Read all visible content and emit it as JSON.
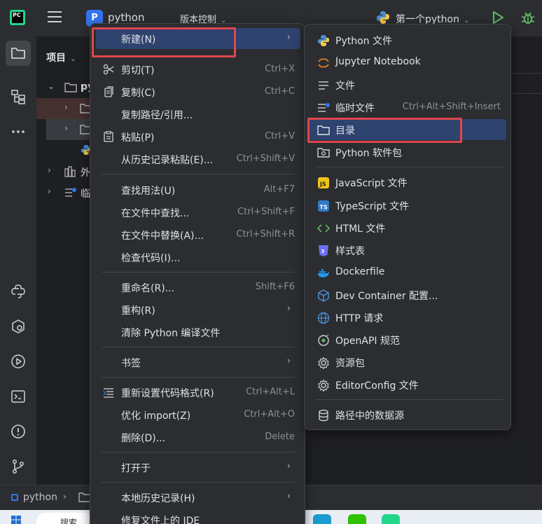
{
  "titlebar": {
    "app_icon_text": "PC",
    "project_initial": "P",
    "project_name": "python",
    "vcs_label": "版本控制",
    "run_config": "第一个python"
  },
  "panel": {
    "title": "项目",
    "tree": [
      {
        "text": "py"
      },
      {
        "text": ""
      },
      {
        "text": ""
      },
      {
        "text": ""
      },
      {
        "text": "外"
      },
      {
        "text": "临"
      }
    ]
  },
  "context_menu": {
    "items": [
      {
        "label": "新建(N)",
        "shortcut": "",
        "submenu": true
      },
      {
        "label": "剪切(T)",
        "shortcut": "Ctrl+X"
      },
      {
        "label": "复制(C)",
        "shortcut": "Ctrl+C"
      },
      {
        "label": "复制路径/引用...",
        "shortcut": ""
      },
      {
        "label": "粘贴(P)",
        "shortcut": "Ctrl+V"
      },
      {
        "label": "从历史记录粘贴(E)...",
        "shortcut": "Ctrl+Shift+V"
      },
      {
        "label": "查找用法(U)",
        "shortcut": "Alt+F7"
      },
      {
        "label": "在文件中查找...",
        "shortcut": "Ctrl+Shift+F"
      },
      {
        "label": "在文件中替换(A)...",
        "shortcut": "Ctrl+Shift+R"
      },
      {
        "label": "检查代码(I)...",
        "shortcut": ""
      },
      {
        "label": "重命名(R)...",
        "shortcut": "Shift+F6"
      },
      {
        "label": "重构(R)",
        "shortcut": "",
        "submenu": true
      },
      {
        "label": "清除 Python 编译文件",
        "shortcut": ""
      },
      {
        "label": "书签",
        "shortcut": "",
        "submenu": true
      },
      {
        "label": "重新设置代码格式(R)",
        "shortcut": "Ctrl+Alt+L"
      },
      {
        "label": "优化 import(Z)",
        "shortcut": "Ctrl+Alt+O"
      },
      {
        "label": "删除(D)...",
        "shortcut": "Delete"
      },
      {
        "label": "打开于",
        "shortcut": "",
        "submenu": true
      },
      {
        "label": "本地历史记录(H)",
        "shortcut": "",
        "submenu": true
      },
      {
        "label": "修复文件上的 IDE",
        "shortcut": ""
      }
    ]
  },
  "submenu": {
    "items": [
      {
        "label": "Python 文件",
        "shortcut": ""
      },
      {
        "label": "Jupyter Notebook",
        "shortcut": ""
      },
      {
        "label": "文件",
        "shortcut": ""
      },
      {
        "label": "临时文件",
        "shortcut": "Ctrl+Alt+Shift+Insert"
      },
      {
        "label": "目录",
        "shortcut": ""
      },
      {
        "label": "Python 软件包",
        "shortcut": ""
      },
      {
        "label": "JavaScript 文件",
        "shortcut": ""
      },
      {
        "label": "TypeScript 文件",
        "shortcut": ""
      },
      {
        "label": "HTML 文件",
        "shortcut": ""
      },
      {
        "label": "样式表",
        "shortcut": ""
      },
      {
        "label": "Dockerfile",
        "shortcut": ""
      },
      {
        "label": "Dev Container 配置...",
        "shortcut": ""
      },
      {
        "label": "HTTP 请求",
        "shortcut": ""
      },
      {
        "label": "OpenAPI 规范",
        "shortcut": ""
      },
      {
        "label": "资源包",
        "shortcut": ""
      },
      {
        "label": "EditorConfig 文件",
        "shortcut": ""
      },
      {
        "label": "路径中的数据源",
        "shortcut": ""
      }
    ]
  },
  "statusbar": {
    "project": "python"
  },
  "taskbar": {
    "search_text": "搜索"
  },
  "colors": {
    "accent": "#3574f0",
    "highlight": "#2e436e",
    "annotation_red": "#e0464e",
    "run_green": "#5fb865"
  }
}
